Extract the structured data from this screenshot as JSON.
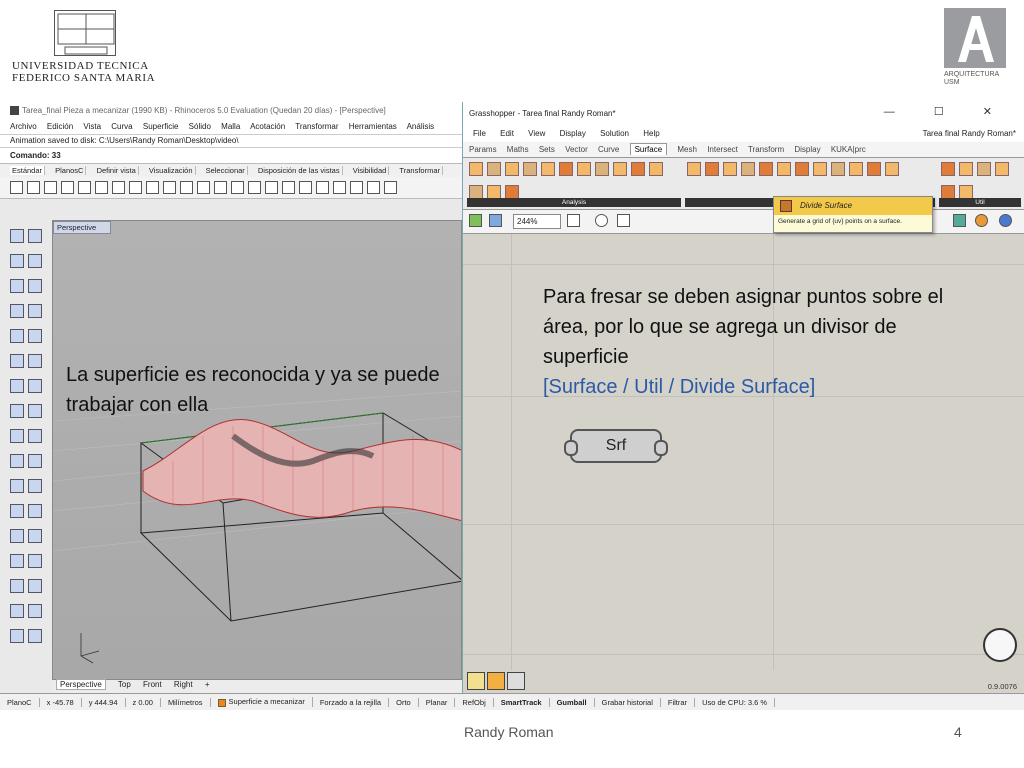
{
  "header": {
    "university_line1": "UNIVERSIDAD TECNICA",
    "university_line2": "FEDERICO SANTA MARIA",
    "arq_line1": "ARQUITECTURA",
    "arq_line2": "USM"
  },
  "rhino": {
    "title": "Tarea_final Pieza a mecanizar (1990 KB) - Rhinoceros 5.0 Evaluation (Quedan 20 días) - [Perspective]",
    "menu": [
      "Archivo",
      "Edición",
      "Vista",
      "Curva",
      "Superficie",
      "Sólido",
      "Malla",
      "Acotación",
      "Transformar",
      "Herramientas",
      "Análisis"
    ],
    "history_line": "Animation saved to disk: C:\\Users\\Randy Roman\\Desktop\\video\\",
    "command_line": "Comando: 33",
    "toolbar_tabs": [
      "Estándar",
      "PlanosC",
      "Definir vista",
      "Visualización",
      "Seleccionar",
      "Disposición de las vistas",
      "Visibilidad",
      "Transformar"
    ],
    "viewport_label": "Perspective",
    "view_tabs": [
      "Perspective",
      "Top",
      "Front",
      "Right",
      "+"
    ]
  },
  "status_bar": {
    "plane": "PlanoC",
    "x": "x -45.78",
    "y": "y 444.94",
    "z": "z 0.00",
    "units": "Milímetros",
    "layer": "Superficie a mecanizar",
    "grid_snap": "Forzado a la rejilla",
    "ortho": "Orto",
    "planar": "Planar",
    "osnap": "RefObj",
    "smarttrack": "SmartTrack",
    "gumball": "Gumball",
    "history": "Grabar historial",
    "filter": "Filtrar",
    "cpu": "Uso de CPU: 3.6 %",
    "layer_color": "#f58220"
  },
  "grasshopper": {
    "title": "Grasshopper - Tarea final Randy Roman*",
    "window_buttons": "— ☐ ✕",
    "menu": [
      "File",
      "Edit",
      "View",
      "Display",
      "Solution",
      "Help"
    ],
    "document_name": "Tarea final Randy Roman*",
    "tabs": [
      "Params",
      "Maths",
      "Sets",
      "Vector",
      "Curve",
      "Surface",
      "Mesh",
      "Intersect",
      "Transform",
      "Display",
      "KUKA|prc"
    ],
    "active_tab": "Surface",
    "ribbon_groups": [
      "Analysis",
      "Freefor",
      "Util"
    ],
    "zoom": "244%",
    "tooltip_title": "Divide Surface",
    "tooltip_text": "Generate a grid of {uv} points on a surface.",
    "node_label": "Srf",
    "version": "0.9.0076"
  },
  "notes": {
    "left": "La superficie es reconocida y ya se puede trabajar con ella",
    "right": "Para fresar se deben asignar puntos sobre el área, por lo que se agrega un divisor de superficie",
    "right_path": "[Surface / Util / Divide Surface]"
  },
  "footer": {
    "author": "Randy Roman",
    "page": "4"
  }
}
